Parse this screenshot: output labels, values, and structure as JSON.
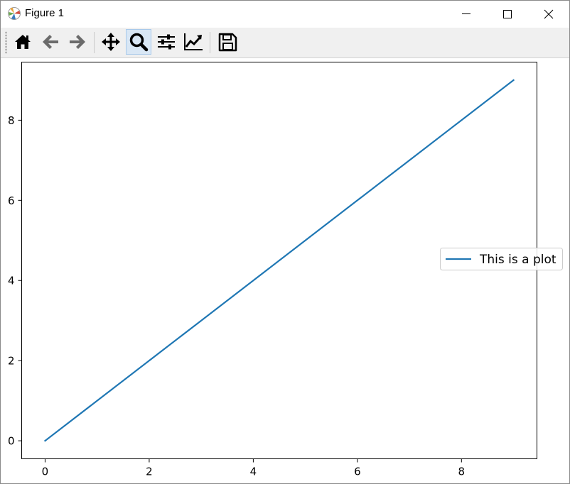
{
  "window": {
    "title": "Figure 1"
  },
  "toolbar": {
    "buttons": [
      {
        "name": "home",
        "icon": "home-icon"
      },
      {
        "name": "back",
        "icon": "arrow-left-icon"
      },
      {
        "name": "forward",
        "icon": "arrow-right-icon"
      },
      {
        "name": "pan",
        "icon": "move-arrows-icon"
      },
      {
        "name": "zoom",
        "icon": "magnifier-icon",
        "active": true
      },
      {
        "name": "configure-subplots",
        "icon": "sliders-icon"
      },
      {
        "name": "edit-axes",
        "icon": "line-chart-icon"
      },
      {
        "name": "save",
        "icon": "floppy-disk-icon"
      }
    ]
  },
  "chart_data": {
    "type": "line",
    "x": [
      0,
      1,
      2,
      3,
      4,
      5,
      6,
      7,
      8,
      9
    ],
    "series": [
      {
        "name": "This is a plot",
        "values": [
          0,
          1,
          2,
          3,
          4,
          5,
          6,
          7,
          8,
          9
        ],
        "color": "#1f77b4"
      }
    ],
    "xlim": [
      -0.45,
      9.45
    ],
    "ylim": [
      -0.45,
      9.45
    ],
    "xticks": [
      "0",
      "2",
      "4",
      "6",
      "8"
    ],
    "yticks": [
      "0",
      "2",
      "4",
      "6",
      "8"
    ],
    "xtick_values": [
      0,
      2,
      4,
      6,
      8
    ],
    "ytick_values": [
      0,
      2,
      4,
      6,
      8
    ],
    "grid": false,
    "legend_position": "center-right"
  }
}
